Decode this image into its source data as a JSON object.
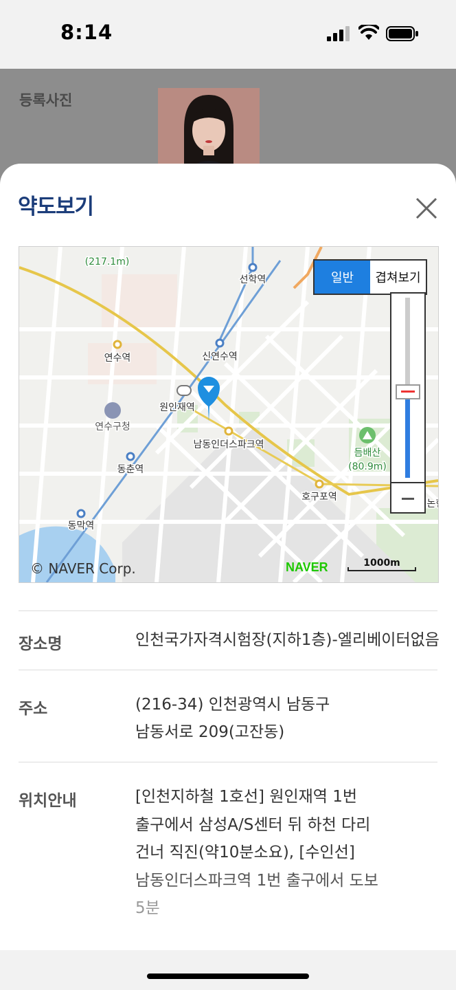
{
  "status_bar": {
    "time": "8:14"
  },
  "background": {
    "label": "등록사진"
  },
  "sheet": {
    "title": "약도보기"
  },
  "map": {
    "toggle": {
      "normal": "일반",
      "overlay": "겹쳐보기"
    },
    "labels": {
      "seonhak": "선학역",
      "yeonsu": "연수역",
      "sinyeonsu": "신연수역",
      "wonin": "원인재역",
      "yeonsu_office": "연수구청",
      "namdong_indus": "남동인더스파크역",
      "dongchun": "동춘역",
      "dongmak": "동막역",
      "hogupo": "호구포역",
      "deumbaesan": "듬배산",
      "deumbaesan_h": "(80.9m)",
      "top_h": "(217.1m)",
      "edge_station": "인천논현역"
    },
    "copyright": "© NAVER Corp.",
    "logo": "NAVER",
    "scale": "1000m"
  },
  "details": {
    "place_label": "장소명",
    "place_value": "인천국가자격시험장(지하1층)-엘리베이터없음",
    "address_label": "주소",
    "address_lines": [
      "(216-34) 인천광역시 남동구",
      "남동서로 209(고잔동)"
    ],
    "guide_label": "위치안내",
    "guide_lines": [
      "[인천지하철 1호선] 원인재역 1번",
      "출구에서 삼성A/S센터 뒤 하천 다리",
      "건너 직진(약10분소요), [수인선]",
      "남동인더스파크역 1번 출구에서 도보",
      "5분"
    ]
  }
}
